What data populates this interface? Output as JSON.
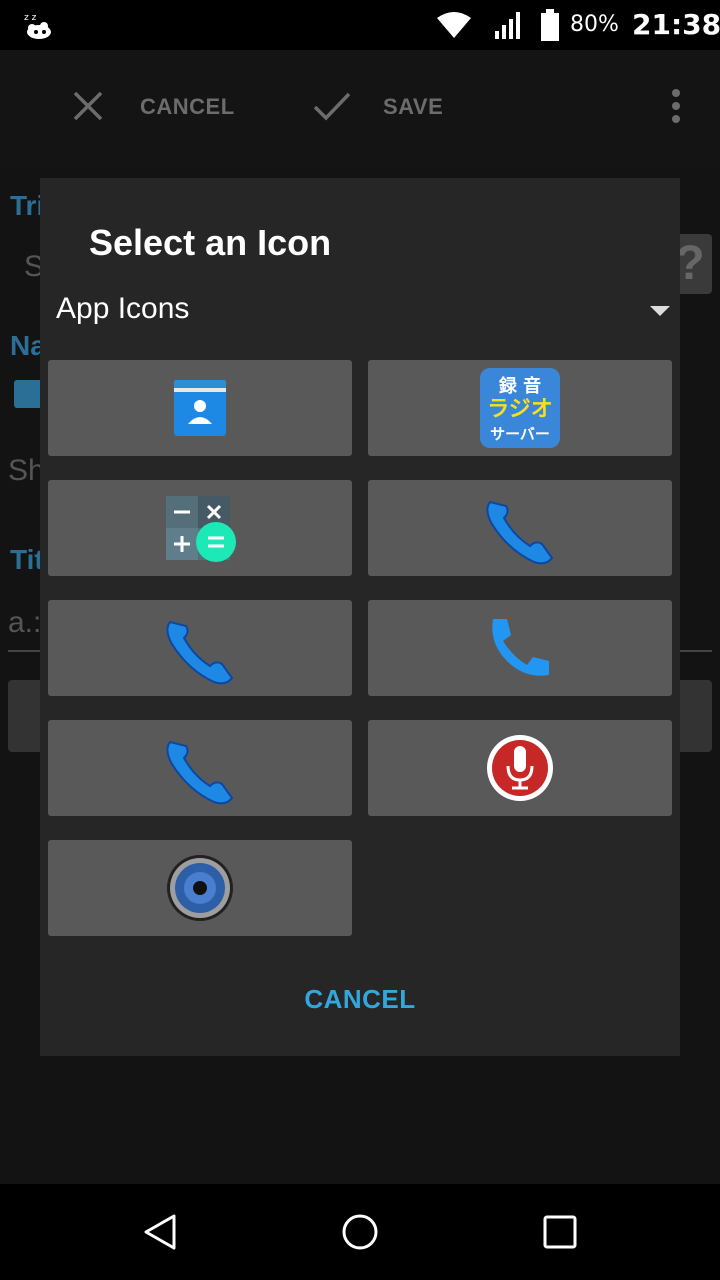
{
  "status_bar": {
    "battery_percent": "80%",
    "time": "21:38",
    "icons": [
      "notification-icon",
      "wifi-icon",
      "signal-icon",
      "battery-icon"
    ]
  },
  "action_bar": {
    "cancel_label": "CANCEL",
    "save_label": "SAVE",
    "icons": [
      "close-icon",
      "check-icon",
      "overflow-menu-icon"
    ]
  },
  "background": {
    "labels": [
      "Tri",
      "S",
      "Na",
      "Sh",
      "Tit",
      "a.:"
    ]
  },
  "dialog": {
    "title": "Select an Icon",
    "dropdown_value": "App Icons",
    "cancel_label": "CANCEL",
    "icons": [
      {
        "name": "contacts-app-icon"
      },
      {
        "name": "radio-server-app-icon",
        "text_line1": "録 音",
        "text_line2": "ラジオ",
        "text_line3": "サーバー"
      },
      {
        "name": "calculator-app-icon"
      },
      {
        "name": "phone-app-icon"
      },
      {
        "name": "phone-app-icon"
      },
      {
        "name": "phone-flat-app-icon"
      },
      {
        "name": "phone-app-icon"
      },
      {
        "name": "voice-recorder-app-icon"
      },
      {
        "name": "speaker-app-icon"
      }
    ]
  },
  "nav_bar": {
    "icons": [
      "back-icon",
      "home-icon",
      "recent-apps-icon"
    ]
  },
  "colors": {
    "accent": "#33a7dc",
    "dialog_bg": "#262626",
    "tile_bg": "#595959"
  }
}
